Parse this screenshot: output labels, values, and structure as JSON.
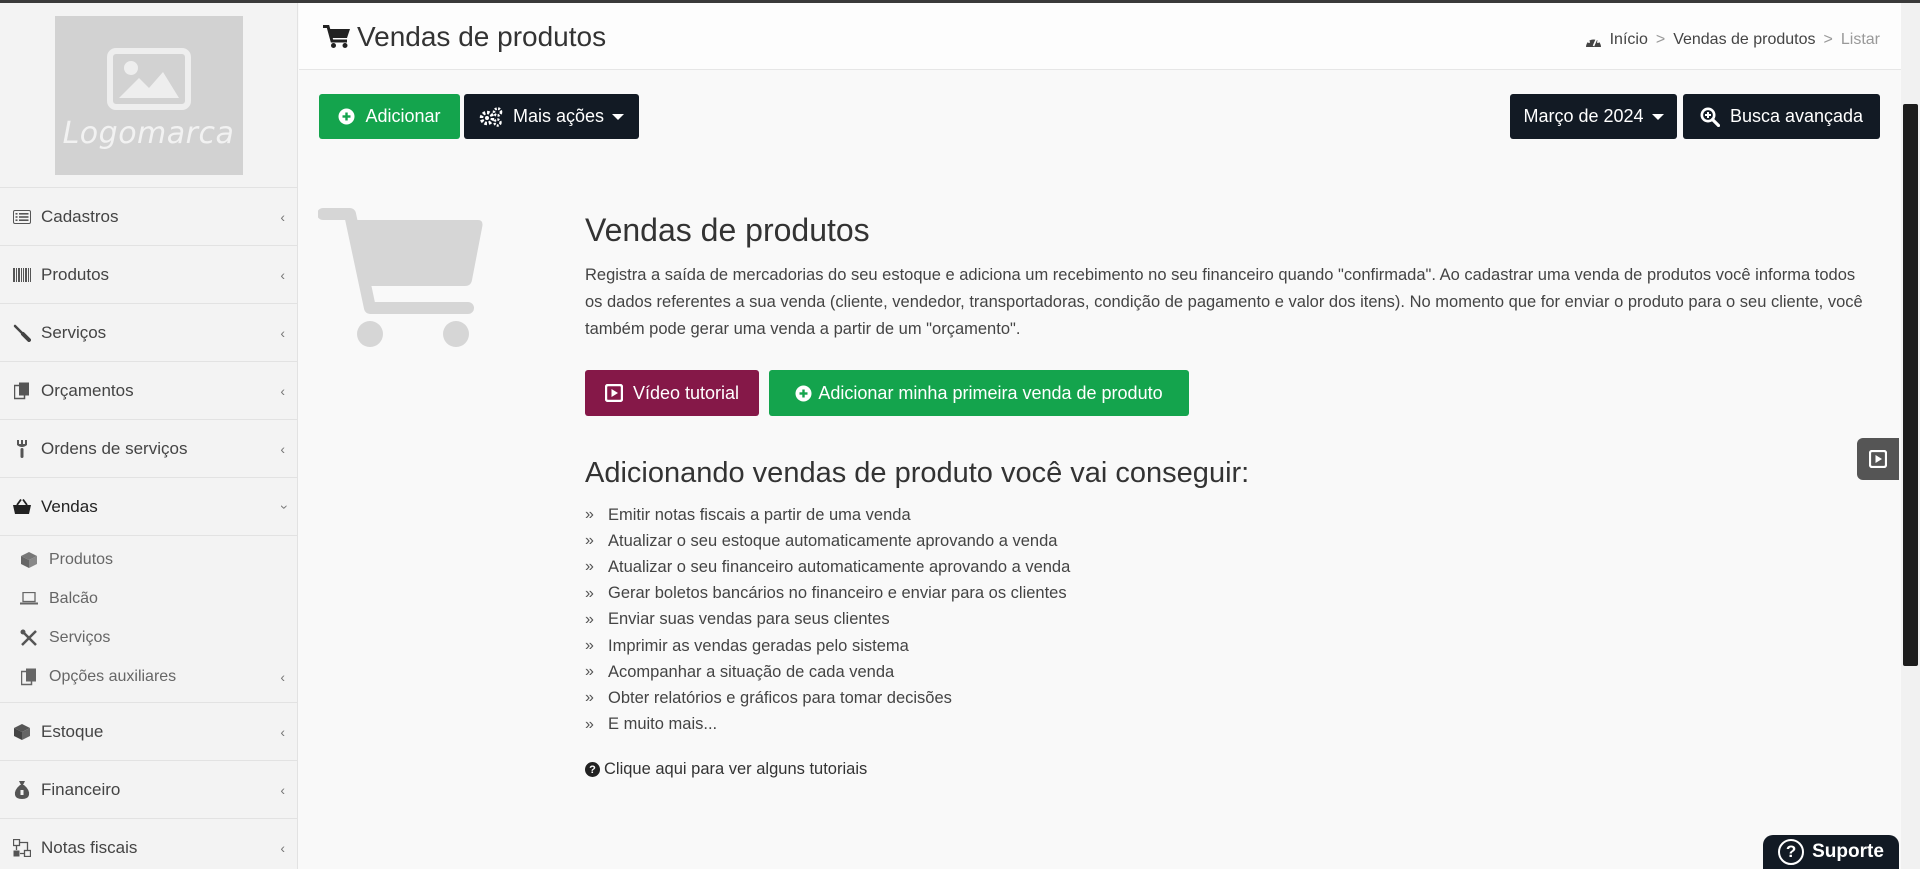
{
  "header": {
    "title": "Vendas de produtos",
    "breadcrumb": [
      "Início",
      "Vendas de produtos",
      "Listar"
    ]
  },
  "sidebar": {
    "logo_text": "Logomarca",
    "items": [
      {
        "label": "Cadastros",
        "icon": "list-icon"
      },
      {
        "label": "Produtos",
        "icon": "barcode-icon"
      },
      {
        "label": "Serviços",
        "icon": "screwdriver-icon"
      },
      {
        "label": "Orçamentos",
        "icon": "copy-icon"
      },
      {
        "label": "Ordens de serviços",
        "icon": "wrench-icon"
      },
      {
        "label": "Vendas",
        "icon": "basket-icon",
        "expanded": true
      }
    ],
    "vendas_sub": [
      {
        "label": "Produtos",
        "icon": "cube-icon"
      },
      {
        "label": "Balcão",
        "icon": "laptop-icon"
      },
      {
        "label": "Serviços",
        "icon": "tools-icon"
      },
      {
        "label": "Opções auxiliares",
        "icon": "copy-icon"
      }
    ],
    "items_after": [
      {
        "label": "Estoque",
        "icon": "cube-icon"
      },
      {
        "label": "Financeiro",
        "icon": "money-bag-icon"
      },
      {
        "label": "Notas fiscais",
        "icon": "sitemap-icon"
      }
    ]
  },
  "toolbar": {
    "add_label": "Adicionar",
    "more_actions_label": "Mais ações",
    "period_label": "Março de 2024",
    "advanced_search_label": "Busca avançada"
  },
  "empty_state": {
    "title": "Vendas de produtos",
    "description": "Registra a saída de mercadorias do seu estoque e adiciona um recebimento no seu financeiro quando \"confirmada\". Ao cadastrar uma venda de produtos você informa todos os dados referentes a sua venda (cliente, vendedor, transportadoras, condição de pagamento e valor dos itens). No momento que for enviar o produto para o seu cliente, você também pode gerar uma venda a partir de um \"orçamento\".",
    "video_button": "Vídeo tutorial",
    "first_sale_button": "Adicionar minha primeira venda de produto",
    "features_title": "Adicionando vendas de produto você vai conseguir:",
    "features": [
      "Emitir notas fiscais a partir de uma venda",
      "Atualizar o seu estoque automaticamente aprovando a venda",
      "Atualizar o seu financeiro automaticamente aprovando a venda",
      "Gerar boletos bancários no financeiro e enviar para os clientes",
      "Enviar suas vendas para seus clientes",
      "Imprimir as vendas geradas pelo sistema",
      "Acompanhar a situação de cada venda",
      "Obter relatórios e gráficos para tomar decisões",
      "E muito mais..."
    ],
    "help_link": "Clique aqui para ver alguns tutoriais"
  },
  "support_label": "Suporte",
  "colors": {
    "green": "#14a44d",
    "dark": "#121a24",
    "maroon": "#851848"
  }
}
